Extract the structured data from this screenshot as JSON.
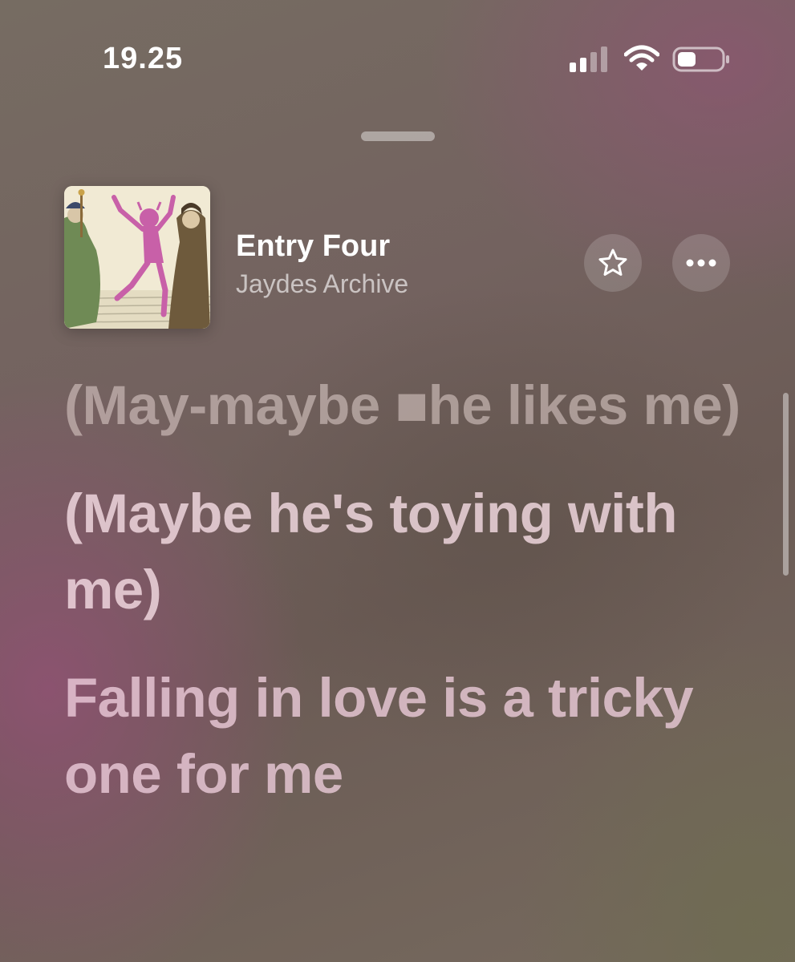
{
  "status_bar": {
    "time": "19.25",
    "signal_icon": "cellular-signal-icon",
    "wifi_icon": "wifi-icon",
    "battery_icon": "battery-icon"
  },
  "now_playing": {
    "title": "Entry Four",
    "artist": "Jaydes Archive",
    "favorite_icon": "star-icon",
    "more_icon": "ellipsis-icon"
  },
  "lyrics": [
    "(May-maybe ■he likes me)",
    "(Maybe he's toying with me)",
    "Falling in love is a tricky one for me"
  ],
  "colors": {
    "background_mauve": "#766c62",
    "background_pink": "#96507a",
    "background_olive": "#6e6c50",
    "text_white": "#ffffff"
  }
}
